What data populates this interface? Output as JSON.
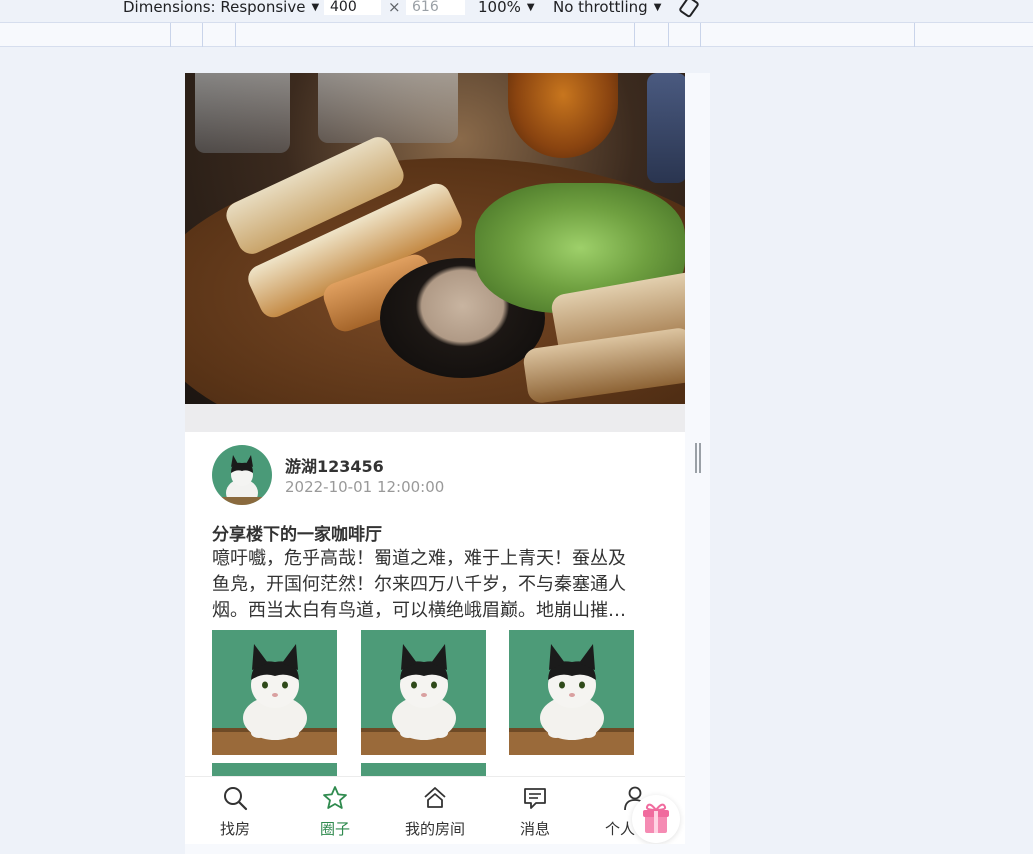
{
  "devtools": {
    "dimensions_label": "Dimensions: Responsive",
    "width_value": "400",
    "times": "×",
    "height_value": "616",
    "zoom": "100%",
    "throttling": "No throttling"
  },
  "post": {
    "user_name": "游湖123456",
    "time": "2022-10-01 12:00:00",
    "title": "分享楼下的一家咖啡厅",
    "body_lines": [
      "噫吁嚱，危乎高哉！蜀道之难，难于上青天！蚕丛及",
      "鱼凫，开国何茫然！尔来四万八千岁，不与秦塞通人",
      "烟。西当太白有鸟道，可以横绝峨眉巅。地崩山摧…"
    ]
  },
  "tabs": [
    {
      "label": "找房",
      "icon": "search-icon",
      "active": false
    },
    {
      "label": "圈子",
      "icon": "star-icon",
      "active": true
    },
    {
      "label": "我的房间",
      "icon": "home-icon",
      "active": false
    },
    {
      "label": "消息",
      "icon": "message-icon",
      "active": false
    },
    {
      "label": "个人中心",
      "icon": "user-icon",
      "active": false
    }
  ],
  "colors": {
    "accent": "#2f8a4e",
    "page_bg": "#eef2f9"
  }
}
